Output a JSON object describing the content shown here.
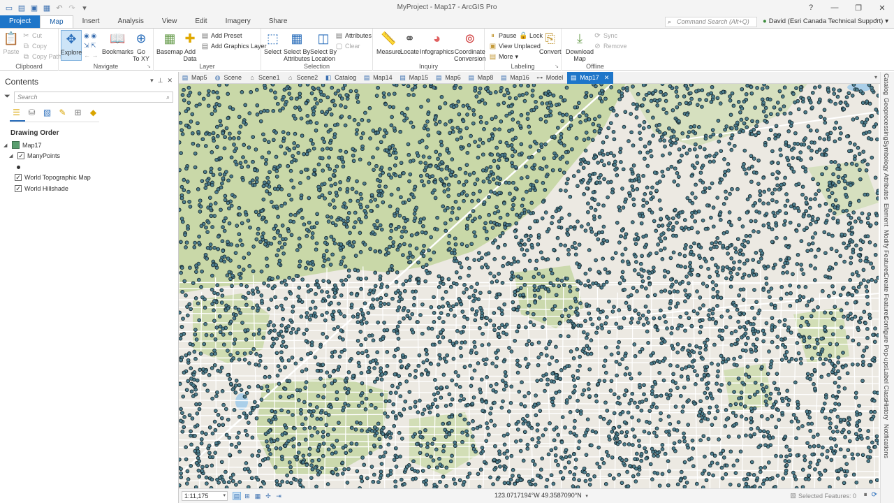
{
  "window": {
    "title": "MyProject - Map17 - ArcGIS Pro",
    "help": "?",
    "minimize": "—",
    "restore": "❐",
    "close": "✕"
  },
  "ribbon_tabs": [
    "Project",
    "Map",
    "Insert",
    "Analysis",
    "View",
    "Edit",
    "Imagery",
    "Share"
  ],
  "command_search": {
    "placeholder": "Command Search (Alt+Q)"
  },
  "user": {
    "name": "David (Esri Canada Technical Support)",
    "dropdown": "▾"
  },
  "ribbon": {
    "clipboard": {
      "label": "Clipboard",
      "paste": "Paste",
      "cut": "Cut",
      "copy": "Copy",
      "copy_path": "Copy Path"
    },
    "navigate": {
      "label": "Navigate",
      "explore": "Explore",
      "bookmarks": "Bookmarks",
      "go_to_xy": "Go\nTo XY"
    },
    "layer": {
      "label": "Layer",
      "basemap": "Basemap",
      "add_data": "Add\nData",
      "add_preset": "Add Preset",
      "add_graphics_layer": "Add Graphics Layer"
    },
    "selection": {
      "label": "Selection",
      "select": "Select",
      "select_by_attributes": "Select By\nAttributes",
      "select_by_location": "Select By\nLocation",
      "attributes": "Attributes",
      "clear": "Clear"
    },
    "inquiry": {
      "label": "Inquiry",
      "measure": "Measure",
      "locate": "Locate",
      "infographics": "Infographics",
      "coordinate_conversion": "Coordinate\nConversion"
    },
    "labeling": {
      "label": "Labeling",
      "pause": "Pause",
      "lock": "Lock",
      "view_unplaced": "View Unplaced",
      "more": "More",
      "convert": "Convert"
    },
    "offline": {
      "label": "Offline",
      "download_map": "Download\nMap",
      "sync": "Sync",
      "remove": "Remove"
    }
  },
  "contents": {
    "title": "Contents",
    "search_placeholder": "Search",
    "drawing_order": "Drawing Order",
    "layers": [
      {
        "name": "Map17"
      },
      {
        "name": "ManyPoints",
        "checked": true
      },
      {
        "name": "World Topographic Map",
        "checked": true
      },
      {
        "name": "World Hillshade",
        "checked": true
      }
    ]
  },
  "map_tabs": [
    "Map5",
    "Scene",
    "Scene1",
    "Scene2",
    "Catalog",
    "Map14",
    "Map15",
    "Map6",
    "Map8",
    "Map16",
    "Model",
    "Map17"
  ],
  "active_map_tab": "Map17",
  "right_dock": [
    "Catalog",
    "Geoprocessing",
    "Symbology",
    "Attributes",
    "Element",
    "Modify Features",
    "Create Features",
    "Configure Pop-ups",
    "Label Class",
    "History",
    "Notifications"
  ],
  "status_bar": {
    "scale": "1:11,175",
    "coordinates": "123.0717194°W 49.3587090°N",
    "selected_features": "Selected Features: 0"
  },
  "colors": {
    "accent": "#1e76c9",
    "point_fill": "#4d7f8f",
    "point_stroke": "#1a2a30",
    "vegetation": "#c9d8a8",
    "land": "#ece9e2"
  }
}
